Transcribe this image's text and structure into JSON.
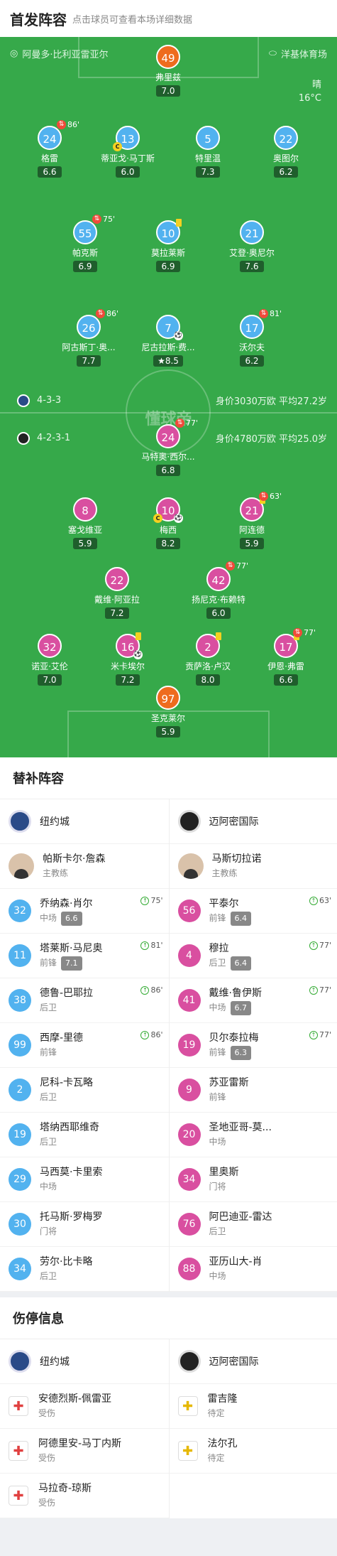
{
  "header": {
    "title": "首发阵容",
    "hint": "点击球员可查看本场详细数据"
  },
  "venue": {
    "stadium": "阿曼多·比利亚雷亚尔",
    "broadcaster": "洋基体育场"
  },
  "weather": {
    "condition": "晴",
    "temp": "16°C"
  },
  "watermark": "懂球帝",
  "home_team": {
    "formation": "4-3-3",
    "value": "身价3030万欧 平均27.2岁",
    "color": "#52b2ef"
  },
  "away_team": {
    "formation": "4-2-3-1",
    "value": "身价4780万欧 平均25.0岁",
    "color": "#d94fa0"
  },
  "pitch_players": [
    {
      "num": "49",
      "name": "弗里兹",
      "rating": "7.0",
      "color": "orange"
    },
    {
      "num": "24",
      "name": "格雷",
      "rating": "6.6",
      "color": "blue",
      "sub": "86'"
    },
    {
      "num": "13",
      "name": "蒂亚戈·马丁斯",
      "rating": "6.0",
      "color": "blue"
    },
    {
      "num": "5",
      "name": "特里温",
      "rating": "7.3",
      "color": "blue"
    },
    {
      "num": "22",
      "name": "奥图尔",
      "rating": "6.2",
      "color": "blue"
    },
    {
      "num": "55",
      "name": "帕克斯",
      "rating": "6.9",
      "color": "blue",
      "sub": "75'"
    },
    {
      "num": "10",
      "name": "莫拉莱斯",
      "rating": "6.9",
      "color": "blue"
    },
    {
      "num": "21",
      "name": "艾登·奥尼尔",
      "rating": "7.6",
      "color": "blue"
    },
    {
      "num": "26",
      "name": "阿古斯丁·奥...",
      "rating": "7.7",
      "color": "blue",
      "sub": "86'"
    },
    {
      "num": "7",
      "name": "尼古拉斯·费...",
      "rating": "8.5",
      "color": "blue"
    },
    {
      "num": "17",
      "name": "沃尔夫",
      "rating": "6.2",
      "color": "blue",
      "sub": "81'"
    },
    {
      "num": "24",
      "name": "马特奥·西尔...",
      "rating": "6.8",
      "color": "pink",
      "sub": "77'"
    },
    {
      "num": "8",
      "name": "塞戈维亚",
      "rating": "5.9",
      "color": "pink"
    },
    {
      "num": "10",
      "name": "梅西",
      "rating": "8.2",
      "color": "pink"
    },
    {
      "num": "21",
      "name": "阿连德",
      "rating": "5.9",
      "color": "pink",
      "sub": "63'"
    },
    {
      "num": "22",
      "name": "戴维·阿亚拉",
      "rating": "7.2",
      "color": "pink"
    },
    {
      "num": "42",
      "name": "扬尼克·布赖特",
      "rating": "6.0",
      "color": "pink",
      "sub": "77'"
    },
    {
      "num": "32",
      "name": "诺亚·艾伦",
      "rating": "7.0",
      "color": "pink"
    },
    {
      "num": "16",
      "name": "米卡埃尔",
      "rating": "7.2",
      "color": "pink"
    },
    {
      "num": "2",
      "name": "贡萨洛·卢汉",
      "rating": "8.0",
      "color": "pink"
    },
    {
      "num": "17",
      "name": "伊恩·弗雷",
      "rating": "6.6",
      "color": "pink",
      "sub": "77'"
    },
    {
      "num": "97",
      "name": "圣克莱尔",
      "rating": "5.9",
      "color": "orange"
    }
  ],
  "subs": {
    "title": "替补阵容",
    "home": {
      "team": "纽约城",
      "coach": "帕斯卡尔·詹森",
      "coach_role": "主教练",
      "players": [
        {
          "num": "32",
          "name": "乔纳森·肖尔",
          "pos": "中场",
          "rating": "6.6",
          "in": "75'"
        },
        {
          "num": "11",
          "name": "塔莱斯·马尼奥",
          "pos": "前锋",
          "rating": "7.1",
          "in": "81'"
        },
        {
          "num": "38",
          "name": "德鲁-巴耶拉",
          "pos": "后卫",
          "rating": "",
          "in": "86'"
        },
        {
          "num": "99",
          "name": "西摩-里德",
          "pos": "前锋",
          "rating": "",
          "in": "86'"
        },
        {
          "num": "2",
          "name": "尼科-卡瓦略",
          "pos": "后卫",
          "rating": "",
          "in": ""
        },
        {
          "num": "19",
          "name": "塔纳西耶维奇",
          "pos": "后卫",
          "rating": "",
          "in": ""
        },
        {
          "num": "29",
          "name": "马西莫·卡里索",
          "pos": "中场",
          "rating": "",
          "in": ""
        },
        {
          "num": "30",
          "name": "托马斯·罗梅罗",
          "pos": "门将",
          "rating": "",
          "in": ""
        },
        {
          "num": "34",
          "name": "劳尔·比卡略",
          "pos": "后卫",
          "rating": "",
          "in": ""
        }
      ]
    },
    "away": {
      "team": "迈阿密国际",
      "coach": "马斯切拉诺",
      "coach_role": "主教练",
      "players": [
        {
          "num": "56",
          "name": "平泰尔",
          "pos": "前锋",
          "rating": "6.4",
          "in": "63'"
        },
        {
          "num": "4",
          "name": "穆拉",
          "pos": "后卫",
          "rating": "6.4",
          "in": "77'"
        },
        {
          "num": "41",
          "name": "戴维·鲁伊斯",
          "pos": "中场",
          "rating": "6.7",
          "in": "77'"
        },
        {
          "num": "19",
          "name": "贝尔泰拉梅",
          "pos": "前锋",
          "rating": "6.3",
          "in": "77'"
        },
        {
          "num": "9",
          "name": "苏亚雷斯",
          "pos": "前锋",
          "rating": "",
          "in": ""
        },
        {
          "num": "20",
          "name": "圣地亚哥-莫...",
          "pos": "中场",
          "rating": "",
          "in": ""
        },
        {
          "num": "34",
          "name": "里奥斯",
          "pos": "门将",
          "rating": "",
          "in": ""
        },
        {
          "num": "76",
          "name": "阿巴迪亚-雷达",
          "pos": "后卫",
          "rating": "",
          "in": ""
        },
        {
          "num": "88",
          "name": "亚历山大-肖",
          "pos": "中场",
          "rating": "",
          "in": ""
        }
      ]
    }
  },
  "injuries": {
    "title": "伤停信息",
    "home": {
      "team": "纽约城",
      "players": [
        {
          "name": "安德烈斯-佩雷亚",
          "status": "受伤"
        },
        {
          "name": "阿德里安-马丁内斯",
          "status": "受伤"
        },
        {
          "name": "马拉奇-琼斯",
          "status": "受伤"
        }
      ]
    },
    "away": {
      "team": "迈阿密国际",
      "players": [
        {
          "name": "雷吉隆",
          "status": "待定"
        },
        {
          "name": "法尔孔",
          "status": "待定"
        }
      ]
    }
  }
}
